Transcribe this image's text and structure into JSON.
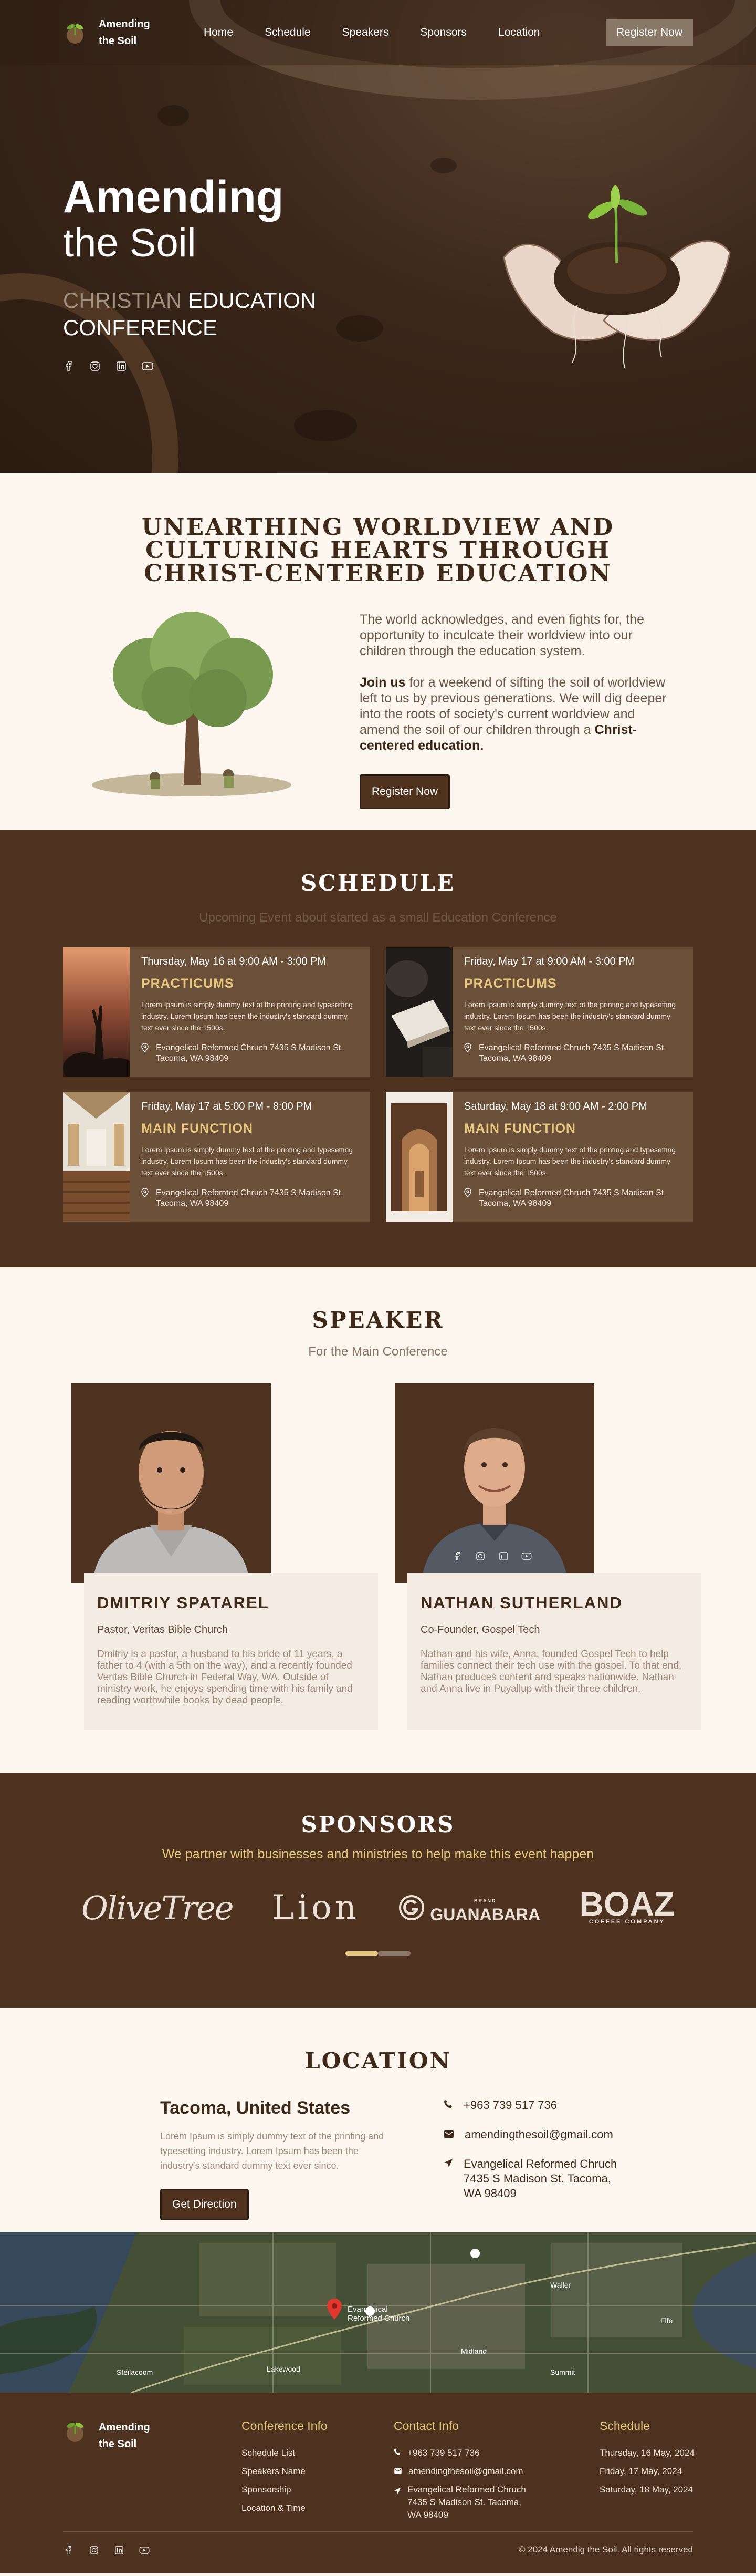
{
  "nav": {
    "brand_line1": "Amending",
    "brand_line2": "the Soil",
    "links": [
      "Home",
      "Schedule",
      "Speakers",
      "Sponsors",
      "Location"
    ],
    "register": "Register Now"
  },
  "hero": {
    "title1": "Amending",
    "title2": "the Soil",
    "sub_dim": "CHRISTIAN",
    "sub_rest": " EDUCATION",
    "sub_line2": "CONFERENCE",
    "social_icons": [
      "facebook-icon",
      "instagram-icon",
      "linkedin-icon",
      "youtube-icon"
    ]
  },
  "about": {
    "heading": "UNEARTHING WORLDVIEW AND CULTURING HEARTS THROUGH CHRIST-CENTERED EDUCATION",
    "p1": "The world acknowledges, and even fights for, the opportunity to inculcate their worldview into our children through the education system.",
    "p2_bold": "Join us",
    "p2_text": " for a weekend of sifting the soil of worldview left to us by previous generations. We will dig deeper into the roots of society's current worldview and amend the soil of our children through a ",
    "p2_bold2": "Christ-centered education.",
    "button": "Register Now"
  },
  "schedule": {
    "heading": "SCHEDULE",
    "lead": "Upcoming Event about started as a small Education Conference",
    "events": [
      {
        "date": "Thursday, May 16 at 9:00 AM - 3:00 PM",
        "title": "PRACTICUMS",
        "desc": "Lorem Ipsum is simply dummy text of the printing and typesetting industry. Lorem Ipsum has been the industry's standard dummy text ever since the 1500s.",
        "loc": "Evangelical Reformed Chruch 7435 S Madison St. Tacoma, WA 98409"
      },
      {
        "date": "Friday, May 17 at 9:00 AM - 3:00 PM",
        "title": "PRACTICUMS",
        "desc": "Lorem Ipsum is simply dummy text of the printing and typesetting industry. Lorem Ipsum has been the industry's standard dummy text ever since the 1500s.",
        "loc": "Evangelical Reformed Chruch 7435 S Madison St. Tacoma, WA 98409"
      },
      {
        "date": "Friday, May 17 at 5:00 PM - 8:00 PM",
        "title": "MAIN FUNCTION",
        "desc": "Lorem Ipsum is simply dummy text of the printing and typesetting industry. Lorem Ipsum has been the industry's standard dummy text ever since the 1500s.",
        "loc": "Evangelical Reformed Chruch 7435 S Madison St. Tacoma, WA 98409"
      },
      {
        "date": "Saturday, May 18 at 9:00 AM - 2:00 PM",
        "title": "MAIN FUNCTION",
        "desc": "Lorem Ipsum is simply dummy text of the printing and typesetting industry. Lorem Ipsum has been the industry's standard dummy text ever since the 1500s.",
        "loc": "Evangelical Reformed Chruch 7435 S Madison St. Tacoma, WA 98409"
      }
    ]
  },
  "speaker": {
    "heading": "SPEAKER",
    "lead": "For the Main Conference",
    "people": [
      {
        "name": "DMITRIY SPATAREL",
        "role": "Pastor, Veritas Bible Church",
        "bio": "Dmitriy is a pastor, a husband to his bride of 11 years, a father to 4 (with a 5th on the way), and a recently founded Veritas Bible Church in Federal Way, WA. Outside of ministry work, he enjoys spending time with his family and reading worthwhile books by dead people."
      },
      {
        "name": "NATHAN SUTHERLAND",
        "role": "Co-Founder, Gospel Tech",
        "bio": "Nathan and his wife, Anna, founded Gospel Tech to help families connect their tech use with the gospel. To that end, Nathan produces content and speaks nationwide. Nathan and Anna live in Puyallup with their three children."
      }
    ]
  },
  "sponsors": {
    "heading": "SPONSORS",
    "lead": "We partner with businesses and ministries to help make this event happen",
    "logos": {
      "olive": "OliveTree",
      "lion": "Lion",
      "gua_top": "BRAND",
      "gua": "GUANABARA",
      "boaz": "BOAZ",
      "boaz_sub": "COFFEE COMPANY"
    }
  },
  "location": {
    "heading": "LOCATION",
    "city": "Tacoma, United States",
    "desc": "Lorem Ipsum is simply dummy text of the printing and typesetting industry. Lorem Ipsum has been the industry's standard dummy text ever since.",
    "button": "Get Direction",
    "phone": "+963 739 517 736",
    "email": "amendingthesoil@gmail.com",
    "address": "Evangelical Reformed Chruch 7435 S Madison St. Tacoma, WA 98409"
  },
  "map": {
    "pin_label": "Evangelical Reformed Church",
    "place1": "Steilacoom",
    "place2": "Lakewood",
    "place3": "Midland",
    "place4": "Summit",
    "place5": "Waller",
    "place6": "Fife"
  },
  "footer": {
    "brand_line1": "Amending",
    "brand_line2": "the Soil",
    "info_title": "Conference Info",
    "info_links": [
      "Schedule List",
      "Speakers Name",
      "Sponsorship",
      "Location & Time"
    ],
    "contact_title": "Contact Info",
    "phone": "+963 739 517 736",
    "email": "amendingthesoil@gmail.com",
    "address": "Evangelical Reformed Chruch 7435 S Madison St. Tacoma, WA 98409",
    "schedule_title": "Schedule",
    "schedule_items": [
      "Thursday, 16 May, 2024",
      "Friday, 17 May, 2024",
      "Saturday, 18 May, 2024"
    ],
    "copyright": "© 2024 Amendig the Soil. All rights reserved"
  }
}
